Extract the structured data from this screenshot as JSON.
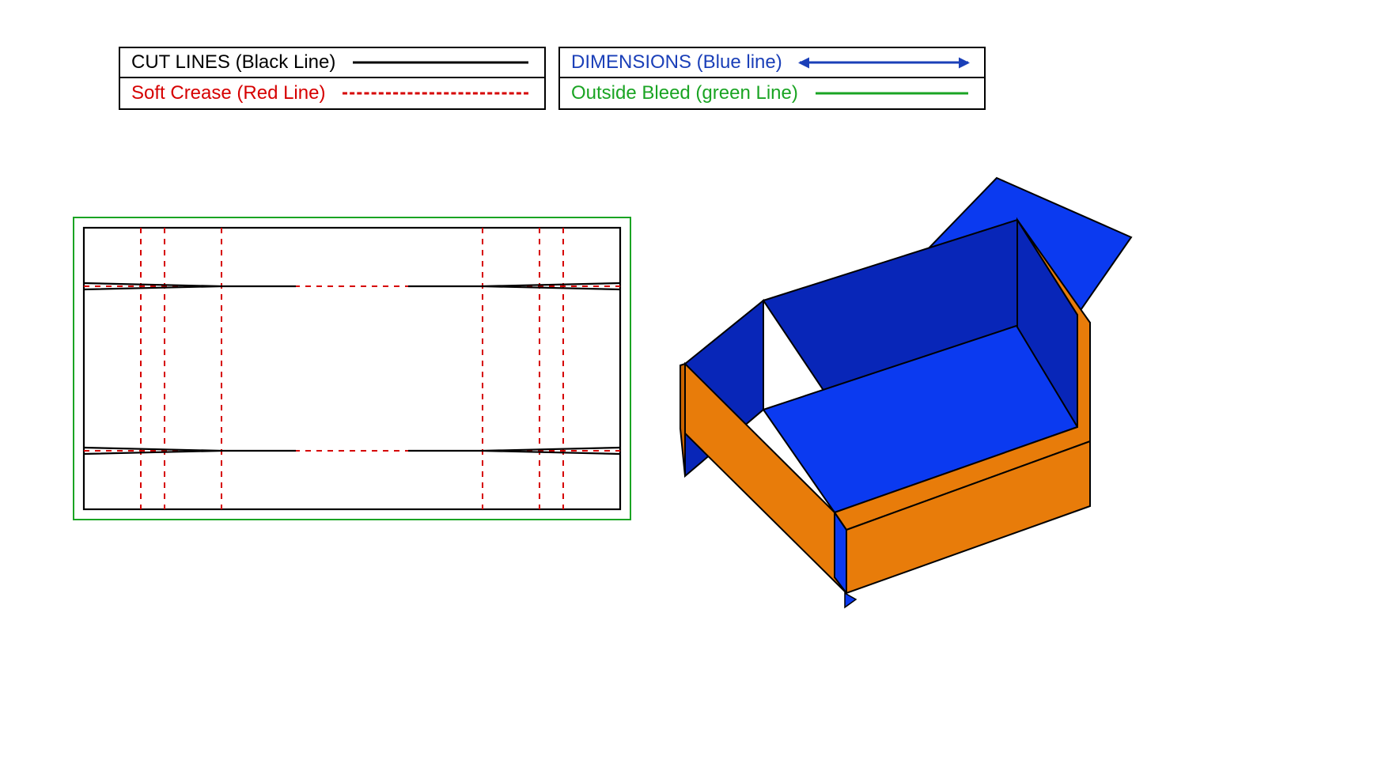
{
  "legend": {
    "left": {
      "rows": [
        {
          "label": "CUT LINES (Black Line)",
          "color_class": "c-black",
          "sample": "solid-black"
        },
        {
          "label": "Soft Crease (Red Line)",
          "color_class": "c-red",
          "sample": "dash-red"
        }
      ]
    },
    "right": {
      "rows": [
        {
          "label": "DIMENSIONS (Blue line)",
          "color_class": "c-blue",
          "sample": "arrow-blue"
        },
        {
          "label": "Outside Bleed (green Line)",
          "color_class": "c-green",
          "sample": "solid-green"
        }
      ]
    }
  },
  "colors": {
    "cut": "#000000",
    "crease": "#d60000",
    "bleed": "#1aa423",
    "dimension": "#1a3fb8",
    "box_outside": "#e87c0a",
    "box_inside": "#0b3af0",
    "box_inside_dark": "#0826b8"
  },
  "dieline_description": "Flat corrugated/shipping tray box dieline with bleed border, outer cut rectangle, two horizontal crease lines forming top and bottom wall panels, four vertical crease pairs creating left/right side walls with roll-over flaps, and notched glue-flap cuts at each corner.",
  "box3d_description": "3D isometric render of the assembled open tray box: orange exterior faces (front, left side seen partially), saturated blue interior faces (floor, inner walls), and a blue lid flap hinged open at the back-right."
}
